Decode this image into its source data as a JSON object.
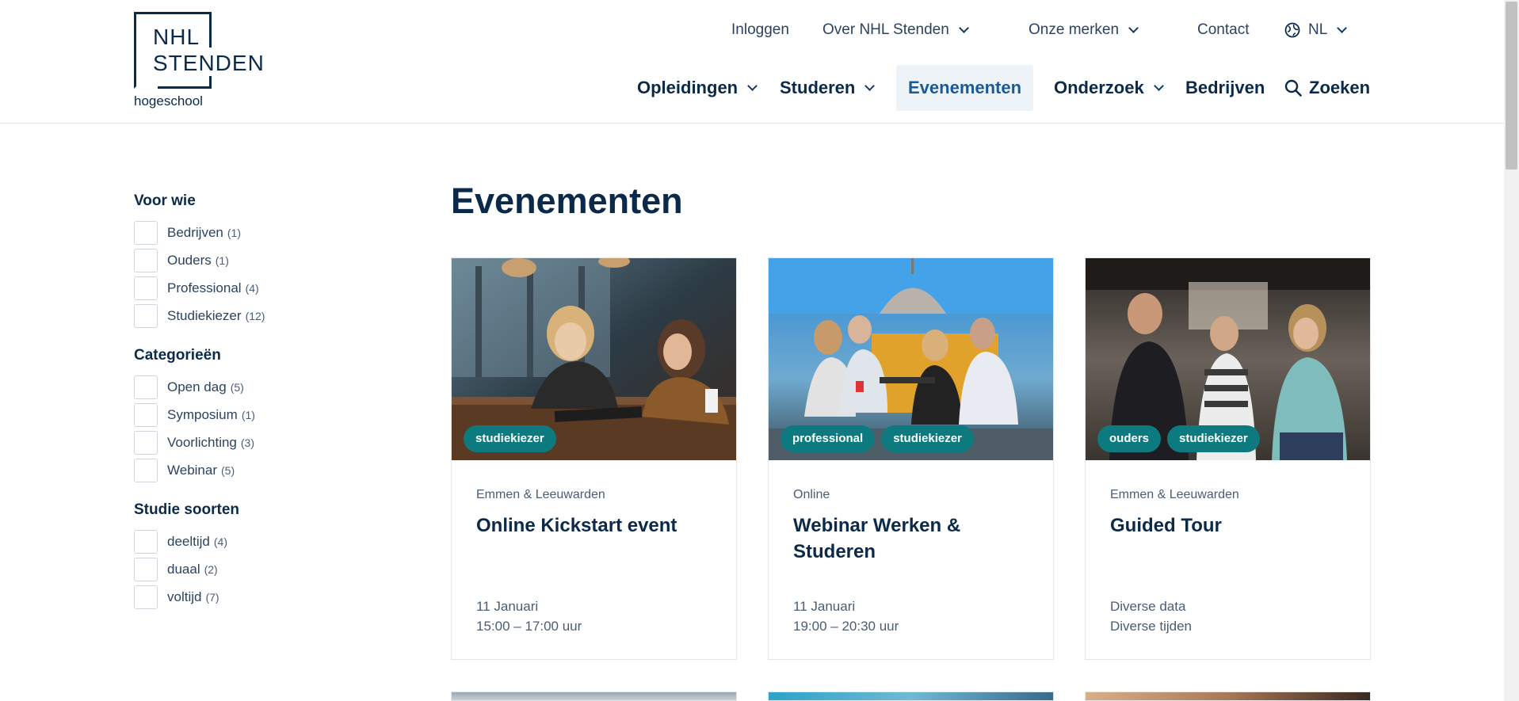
{
  "logo": {
    "line1": "NHL",
    "line2": "STENDEN",
    "sub": "hogeschool"
  },
  "topnav": {
    "login": "Inloggen",
    "about": "Over NHL Stenden",
    "brands": "Onze merken",
    "contact": "Contact",
    "language": "NL",
    "icons": {
      "language": "globe-icon",
      "dropdown": "chevron-down-icon"
    }
  },
  "mainnav": {
    "items": [
      {
        "label": "Opleidingen",
        "dropdown": true
      },
      {
        "label": "Studeren",
        "dropdown": true
      },
      {
        "label": "Evenementen",
        "active": true
      },
      {
        "label": "Onderzoek",
        "dropdown": true
      },
      {
        "label": "Bedrijven"
      }
    ],
    "search": "Zoeken",
    "search_icon": "search-icon"
  },
  "filters": {
    "groups": [
      {
        "title": "Voor wie",
        "options": [
          {
            "label": "Bedrijven",
            "count": "(1)"
          },
          {
            "label": "Ouders",
            "count": "(1)"
          },
          {
            "label": "Professional",
            "count": "(4)"
          },
          {
            "label": "Studiekiezer",
            "count": "(12)"
          }
        ]
      },
      {
        "title": "Categorieën",
        "options": [
          {
            "label": "Open dag",
            "count": "(5)"
          },
          {
            "label": "Symposium",
            "count": "(1)"
          },
          {
            "label": "Voorlichting",
            "count": "(3)"
          },
          {
            "label": "Webinar",
            "count": "(5)"
          }
        ]
      },
      {
        "title": "Studie soorten",
        "options": [
          {
            "label": "deeltijd",
            "count": "(4)"
          },
          {
            "label": "duaal",
            "count": "(2)"
          },
          {
            "label": "voltijd",
            "count": "(7)"
          }
        ]
      }
    ]
  },
  "main": {
    "title": "Evenementen",
    "cards": [
      {
        "tags": [
          "studiekiezer"
        ],
        "location": "Emmen & Leeuwarden",
        "title": "Online Kickstart event",
        "date": "11 Januari",
        "time": "15:00 – 17:00 uur"
      },
      {
        "tags": [
          "professional",
          "studiekiezer"
        ],
        "location": "Online",
        "title": "Webinar Werken & Studeren",
        "date": "11 Januari",
        "time": "19:00 – 20:30 uur"
      },
      {
        "tags": [
          "ouders",
          "studiekiezer"
        ],
        "location": "Emmen & Leeuwarden",
        "title": "Guided Tour",
        "date": "Diverse data",
        "time": "Diverse tijden"
      }
    ]
  },
  "colors": {
    "navy": "#0b2a4a",
    "accent_blue": "#1a5a96",
    "tag_teal": "#0d7a80",
    "active_bg": "#eef3f8"
  }
}
